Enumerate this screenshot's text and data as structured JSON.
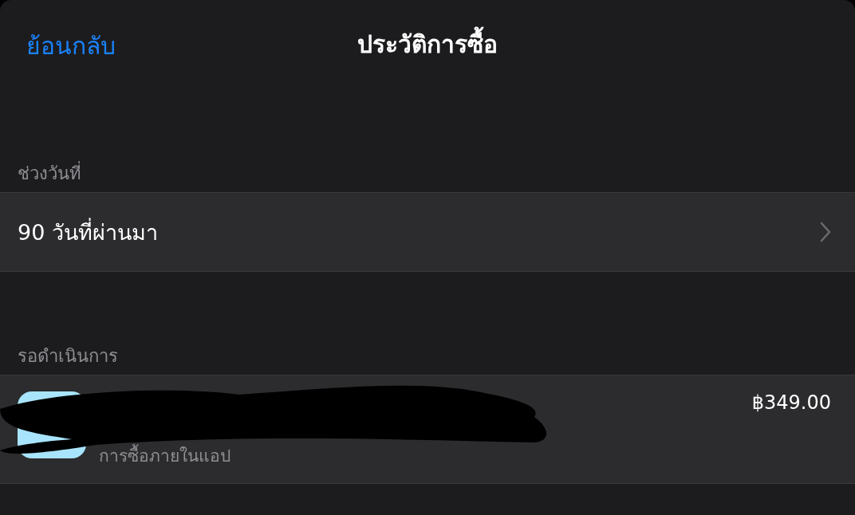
{
  "nav": {
    "back": "ย้อนกลับ",
    "title": "ประวัติการซื้อ"
  },
  "date_section": {
    "header": "ช่วงวันที่",
    "value": "90 วันที่ผ่านมา"
  },
  "pending_section": {
    "header": "รอดำเนินการ",
    "items": [
      {
        "subtitle": "การซื้อภายในแอป",
        "price": "฿349.00"
      }
    ]
  }
}
